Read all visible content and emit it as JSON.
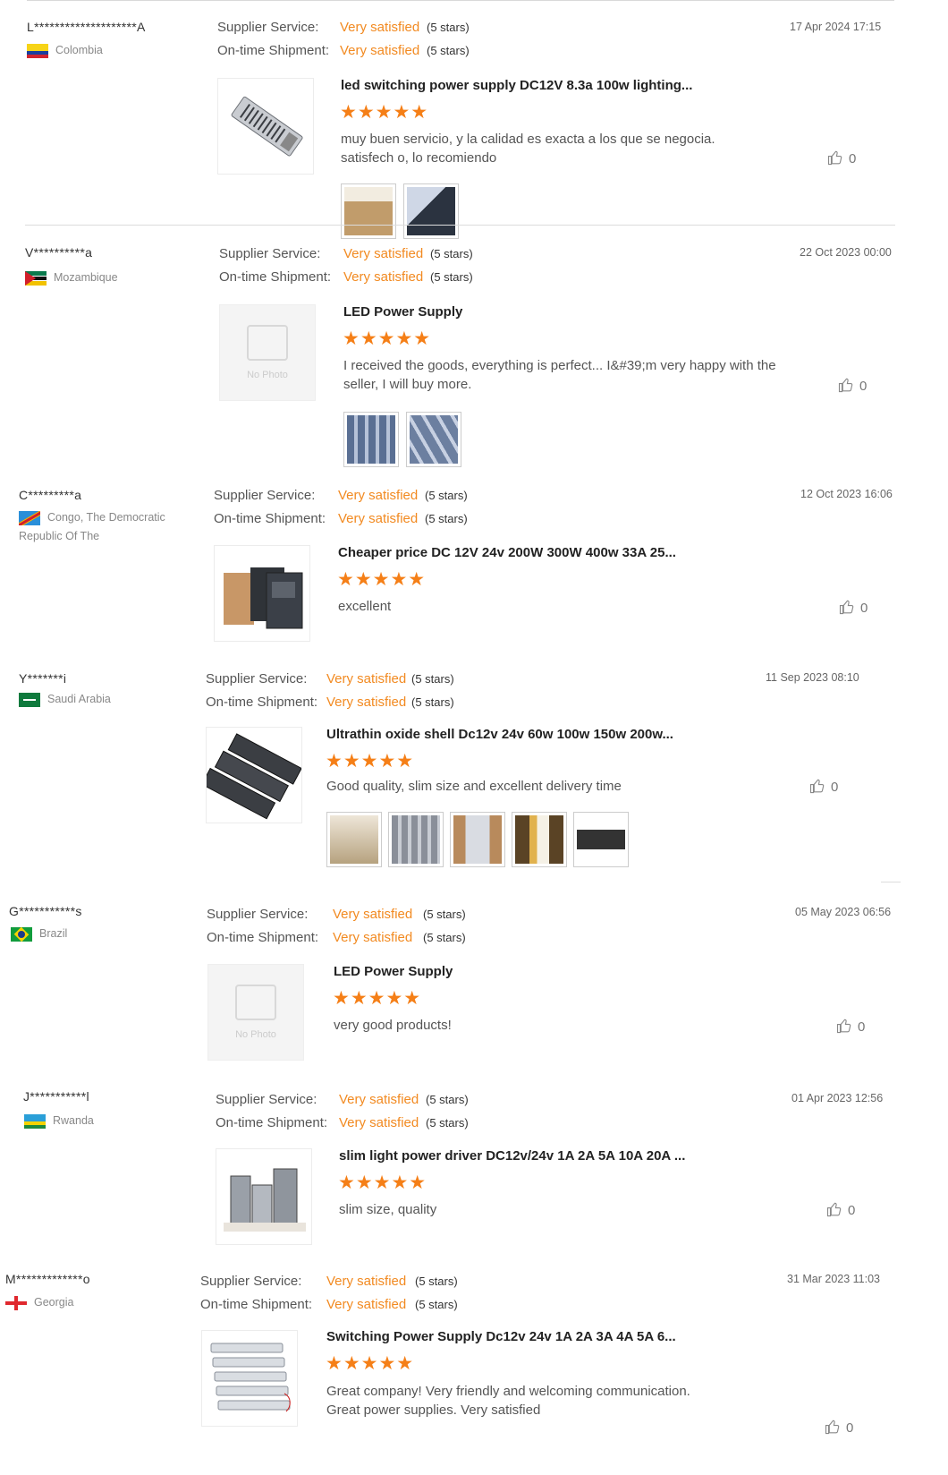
{
  "labels": {
    "supplier_service": "Supplier Service:",
    "ontime_shipment": "On-time Shipment:"
  },
  "reviews": [
    {
      "user": "L********************A",
      "country": "Colombia",
      "flag": "colombia",
      "supplier_value": "Very satisfied",
      "supplier_stars": "(5 stars)",
      "shipment_value": "Very satisfied",
      "shipment_stars": "(5 stars)",
      "date": "17 Apr 2024 17:15",
      "product_title": "led switching power supply DC12V 8.3a 100w lighting...",
      "stars": "★★★★★",
      "review_text": "muy buen servicio, y la calidad es exacta a los que se negocia. satisfech o, lo recomiendo",
      "likes": "0",
      "photo_count": 2
    },
    {
      "user": "V**********a",
      "country": "Mozambique",
      "flag": "mozambique",
      "supplier_value": "Very satisfied",
      "supplier_stars": "(5 stars)",
      "shipment_value": "Very satisfied",
      "shipment_stars": "(5 stars)",
      "date": "22 Oct 2023 00:00",
      "product_title": "LED Power Supply",
      "no_photo_text": "No Photo",
      "stars": "★★★★★",
      "review_text": "I received the goods, everything is perfect... I&#39;m very happy with the seller, I will buy more.",
      "likes": "0",
      "photo_count": 2
    },
    {
      "user": "C*********a",
      "country": "Congo, The Democratic Republic Of The",
      "flag": "drc",
      "supplier_value": "Very satisfied",
      "supplier_stars": "(5 stars)",
      "shipment_value": "Very satisfied",
      "shipment_stars": "(5 stars)",
      "date": "12 Oct 2023 16:06",
      "product_title": "Cheaper price DC 12V 24v 200W 300W 400w 33A 25...",
      "stars": "★★★★★",
      "review_text": "excellent",
      "likes": "0",
      "photo_count": 0
    },
    {
      "user": "Y*******i",
      "country": "Saudi Arabia",
      "flag": "saudi",
      "supplier_value": "Very satisfied",
      "supplier_stars": "(5 stars)",
      "shipment_value": "Very satisfied",
      "shipment_stars": "(5 stars)",
      "date": "11 Sep 2023 08:10",
      "product_title": "Ultrathin oxide shell Dc12v 24v 60w 100w 150w 200w...",
      "stars": "★★★★★",
      "review_text": "Good  quality, slim size and excellent delivery time",
      "likes": "0",
      "photo_count": 5
    },
    {
      "user": "G***********s",
      "country": "Brazil",
      "flag": "brazil",
      "supplier_value": "Very satisfied",
      "supplier_stars": "(5 stars)",
      "shipment_value": "Very satisfied",
      "shipment_stars": "(5 stars)",
      "date": "05 May 2023 06:56",
      "product_title": "LED Power Supply",
      "no_photo_text": "No Photo",
      "stars": "★★★★★",
      "review_text": "very good products!",
      "likes": "0",
      "photo_count": 0
    },
    {
      "user": "J***********l",
      "country": "Rwanda",
      "flag": "rwanda",
      "supplier_value": "Very satisfied",
      "supplier_stars": "(5 stars)",
      "shipment_value": "Very satisfied",
      "shipment_stars": "(5 stars)",
      "date": "01 Apr 2023 12:56",
      "product_title": "slim light power driver DC12v/24v 1A 2A 5A 10A 20A ...",
      "stars": "★★★★★",
      "review_text": "slim size, quality",
      "likes": "0",
      "photo_count": 0
    },
    {
      "user": "M*************o",
      "country": "Georgia",
      "flag": "georgia",
      "supplier_value": "Very satisfied",
      "supplier_stars": "(5 stars)",
      "shipment_value": "Very satisfied",
      "shipment_stars": "(5 stars)",
      "date": "31 Mar 2023 11:03",
      "product_title": "Switching Power Supply Dc12v 24v 1A 2A 3A 4A 5A 6...",
      "stars": "★★★★★",
      "review_text": "Great company! Very friendly and welcoming communication. Great power supplies. Very satisfied",
      "likes": "0",
      "photo_count": 0
    }
  ]
}
